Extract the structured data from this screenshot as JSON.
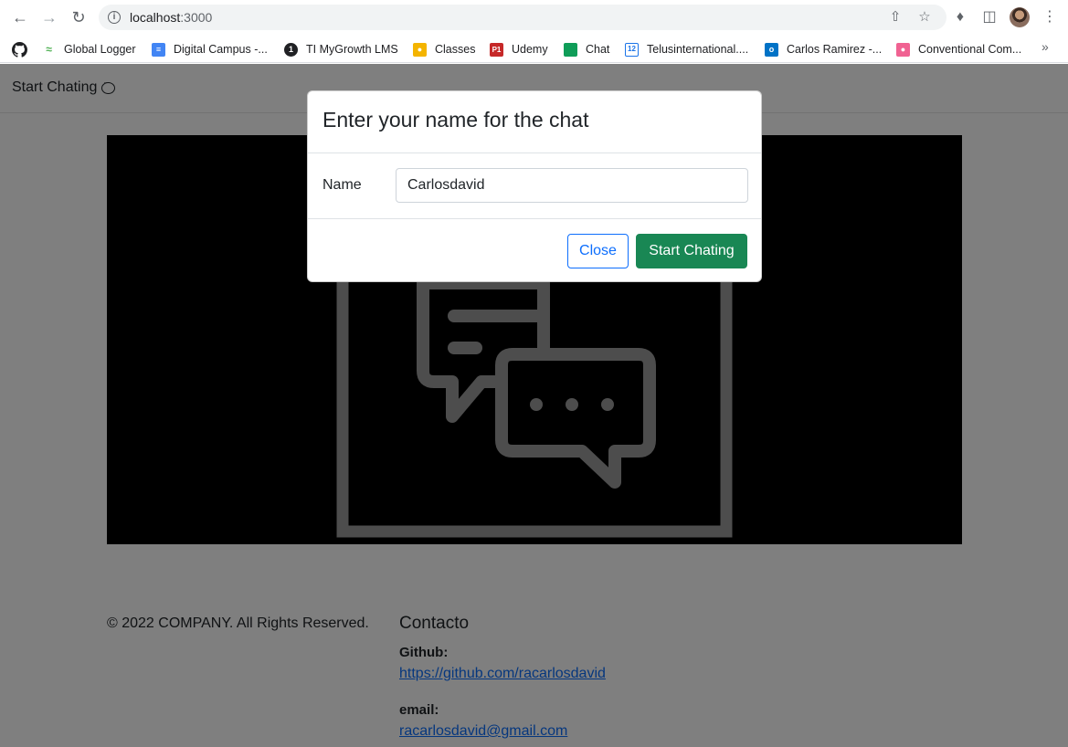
{
  "browser": {
    "url_host": "localhost",
    "url_port": ":3000",
    "bookmarks": [
      {
        "label": "Global Logger",
        "color": "#4caf50"
      },
      {
        "label": "Digital Campus -...",
        "color": "#4285f4"
      },
      {
        "label": "TI MyGrowth LMS",
        "color": "#202124"
      },
      {
        "label": "Classes",
        "color": "#f4b400"
      },
      {
        "label": "Udemy",
        "color": "#c62828"
      },
      {
        "label": "Chat",
        "color": "#0f9d58"
      },
      {
        "label": "Telusinternational....",
        "color": "#1a73e8"
      },
      {
        "label": "Carlos Ramirez -...",
        "color": "#0072c6"
      },
      {
        "label": "Conventional Com...",
        "color": "#f06292"
      }
    ],
    "more": "»"
  },
  "navbar": {
    "brand": "Start Chating"
  },
  "footer": {
    "copyright": "© 2022 COMPANY. All Rights Reserved.",
    "contact_title": "Contacto",
    "github_label": "Github:",
    "github_link": "https://github.com/racarlosdavid",
    "email_label": "email:",
    "email_link": "racarlosdavid@gmail.com"
  },
  "modal": {
    "title": "Enter your name for the chat",
    "name_label": "Name",
    "name_value": "Carlosdavid",
    "close_label": "Close",
    "start_label": "Start Chating"
  },
  "colors": {
    "primary": "#0d6efd",
    "success": "#198754",
    "hero_bg": "#000000"
  }
}
